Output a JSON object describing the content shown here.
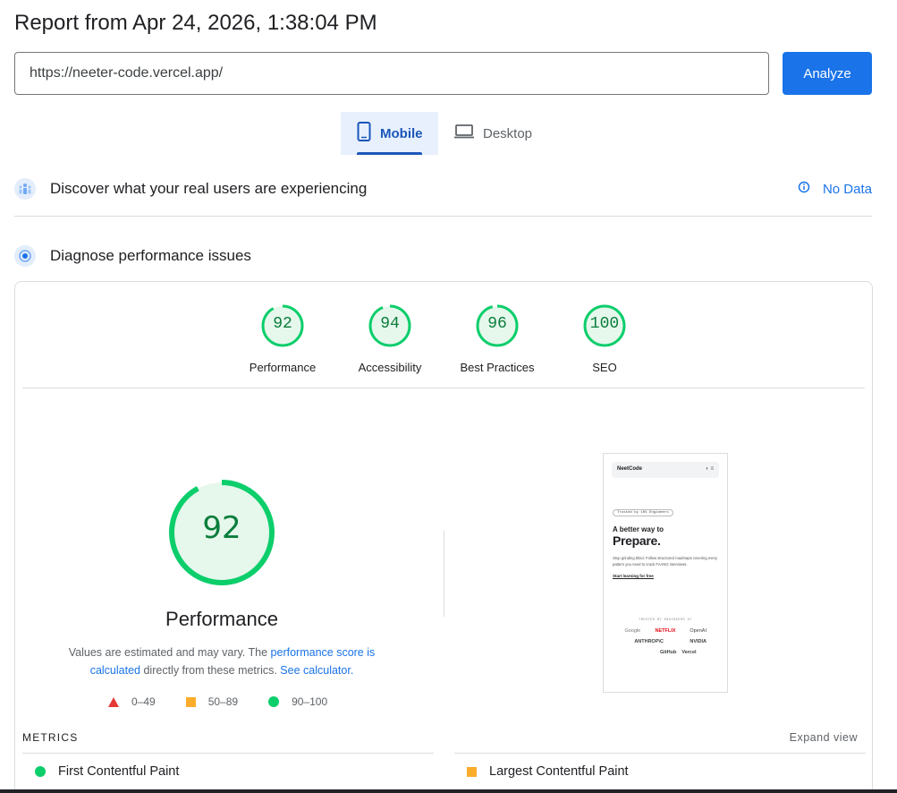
{
  "header": {
    "title": "Report from Apr 24, 2026, 1:38:04 PM"
  },
  "url_bar": {
    "value": "https://neeter-code.vercel.app/",
    "analyze_label": "Analyze"
  },
  "tabs": [
    {
      "label": "Mobile",
      "icon": "phone-icon",
      "active": true
    },
    {
      "label": "Desktop",
      "icon": "laptop-icon",
      "active": false
    }
  ],
  "field_data": {
    "title": "Discover what your real users are experiencing",
    "status": "No Data",
    "icon": "users-icon"
  },
  "lab_data": {
    "title": "Diagnose performance issues",
    "icon": "diagnose-icon"
  },
  "categories": [
    {
      "score": "92",
      "label": "Performance"
    },
    {
      "score": "94",
      "label": "Accessibility"
    },
    {
      "score": "96",
      "label": "Best Practices"
    },
    {
      "score": "100",
      "label": "SEO"
    }
  ],
  "performance": {
    "score": "92",
    "title": "Performance",
    "desc_prefix": "Values are estimated and may vary. The ",
    "desc_link1": "performance score is calculated",
    "desc_middle": " directly from these metrics. ",
    "desc_link2": "See calculator."
  },
  "legend": [
    {
      "range": "0–49",
      "shape": "triangle",
      "color": "#e53935"
    },
    {
      "range": "50–89",
      "shape": "square",
      "color": "#fbac2a"
    },
    {
      "range": "90–100",
      "shape": "circle",
      "color": "#0cce6b"
    }
  ],
  "screenshot": {
    "brand": "NeetCode",
    "pill": "Trusted by 10k Engineers",
    "heading_small": "A better way to",
    "heading_big": "Prepare.",
    "body": "Stop grinding blind. Follow structured roadmaps covering every pattern you need to crack FAANG interviews.",
    "link": "Start learning for free",
    "trusted": "TRUSTED BY ENGINEERS AT",
    "logos": [
      "Google",
      "NETFLIX",
      "OpenAI",
      "ANTHROP\\C",
      "NVIDIA",
      "GitHub",
      "Vercel"
    ]
  },
  "metrics": {
    "label": "METRICS",
    "expand_label": "Expand view",
    "items": [
      {
        "name": "First Contentful Paint",
        "status": "good"
      },
      {
        "name": "Largest Contentful Paint",
        "status": "average"
      }
    ]
  },
  "colors": {
    "accent": "#1a73e8",
    "pass": "#0cce6b",
    "average": "#fbac2a",
    "fail": "#e53935"
  }
}
